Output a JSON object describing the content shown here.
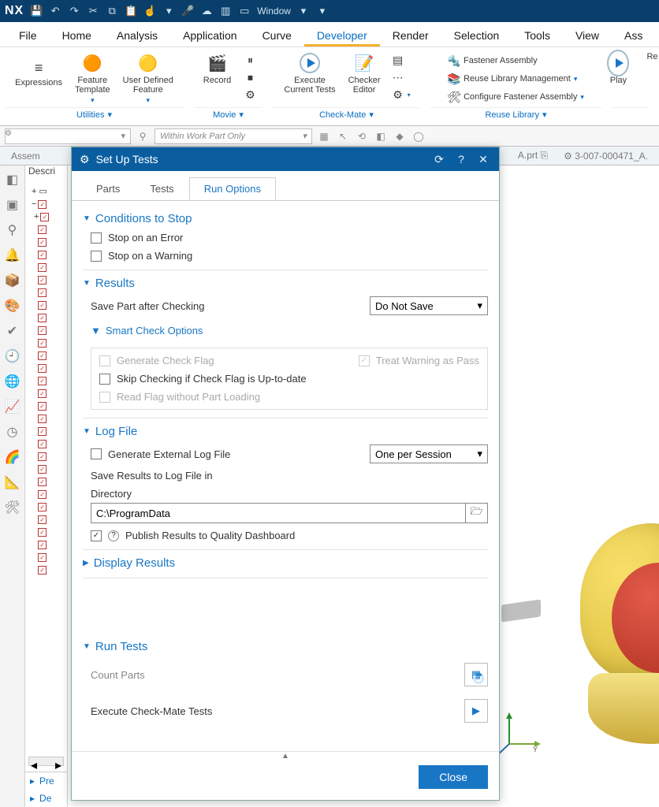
{
  "titlebar": {
    "logo": "NX",
    "window_label": "Window"
  },
  "menu": {
    "items": [
      "File",
      "Home",
      "Analysis",
      "Application",
      "Curve",
      "Developer",
      "Render",
      "Selection",
      "Tools",
      "View",
      "Ass"
    ],
    "active_index": 5
  },
  "ribbon": {
    "utilities": {
      "label": "Utilities",
      "expressions": "Expressions",
      "feature_template": "Feature\nTemplate",
      "user_defined_feature": "User Defined\nFeature"
    },
    "movie": {
      "label": "Movie",
      "record": "Record"
    },
    "checkmate": {
      "label": "Check-Mate",
      "execute": "Execute\nCurrent Tests",
      "checker_editor": "Checker\nEditor"
    },
    "reuse": {
      "label": "Reuse Library",
      "fastener_assembly": "Fastener Assembly",
      "reuse_mgmt": "Reuse Library Management",
      "config_fastener": "Configure Fastener Assembly"
    },
    "play": "Play",
    "re": "Re"
  },
  "filterbar": {
    "scope": "Within Work Part Only"
  },
  "doctabs": {
    "assem_label": "Assem",
    "descri_label": "Descri",
    "file1": "A.prt",
    "file2": "3-007-000471_A."
  },
  "assembly_footer": {
    "pre": "Pre",
    "de": "De"
  },
  "dialog": {
    "title": "Set Up Tests",
    "tabs": {
      "parts": "Parts",
      "tests": "Tests",
      "run_options": "Run Options"
    },
    "conditions": {
      "header": "Conditions to Stop",
      "stop_error": "Stop on an Error",
      "stop_warning": "Stop on a Warning"
    },
    "results": {
      "header": "Results",
      "save_part_label": "Save Part after Checking",
      "save_part_value": "Do Not Save",
      "smart_header": "Smart Check Options",
      "gen_flag": "Generate Check Flag",
      "treat_warning": "Treat Warning as Pass",
      "skip_check": "Skip Checking if Check Flag is Up-to-date",
      "read_flag": "Read Flag without Part Loading"
    },
    "logfile": {
      "header": "Log File",
      "gen_external": "Generate External Log File",
      "freq_value": "One per Session",
      "save_results_label": "Save Results to Log File in",
      "directory_label": "Directory",
      "directory_value": "C:\\ProgramData",
      "publish": "Publish Results to Quality Dashboard"
    },
    "display_results": {
      "header": "Display Results"
    },
    "run_tests": {
      "header": "Run Tests",
      "count_parts": "Count Parts",
      "execute": "Execute Check-Mate Tests"
    },
    "close": "Close"
  }
}
